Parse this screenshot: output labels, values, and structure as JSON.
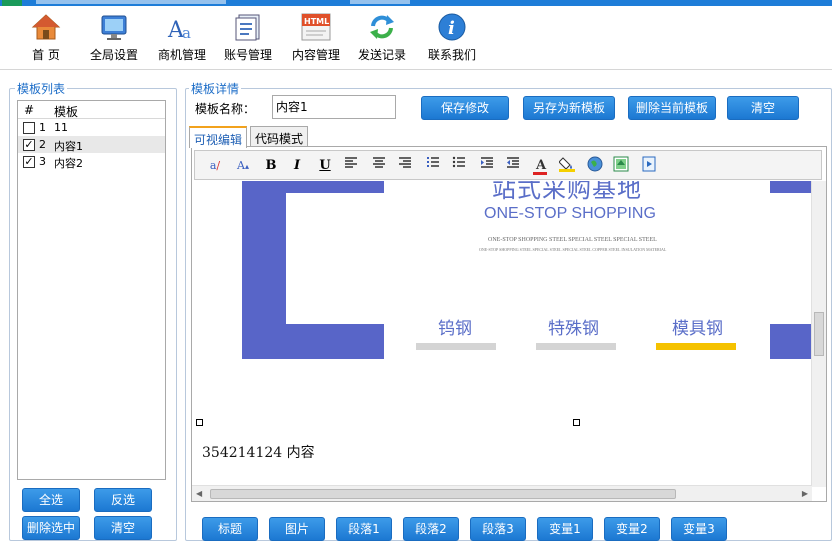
{
  "toolbar": {
    "items": [
      {
        "label": "首 页",
        "icon": "home-icon"
      },
      {
        "label": "全局设置",
        "icon": "monitor-settings-icon"
      },
      {
        "label": "商机管理",
        "icon": "font-aa-icon"
      },
      {
        "label": "账号管理",
        "icon": "account-list-icon"
      },
      {
        "label": "内容管理",
        "icon": "html-doc-icon"
      },
      {
        "label": "发送记录",
        "icon": "refresh-arrows-icon"
      },
      {
        "label": "联系我们",
        "icon": "info-icon"
      }
    ],
    "html_badge": "HTML"
  },
  "template_list": {
    "title": "模板列表",
    "columns": [
      "#",
      "模板"
    ],
    "rows": [
      {
        "num": "1",
        "name": "11",
        "checked": false
      },
      {
        "num": "2",
        "name": "内容1",
        "checked": true
      },
      {
        "num": "3",
        "name": "内容2",
        "checked": true
      }
    ],
    "buttons": {
      "select_all": "全选",
      "invert": "反选",
      "delete_selected": "删除选中",
      "clear": "清空"
    }
  },
  "template_detail": {
    "title": "模板详情",
    "name_label": "模板名称：",
    "name_value": "内容1",
    "buttons": {
      "save": "保存修改",
      "save_as": "另存为新模板",
      "delete": "删除当前模板",
      "clear": "清空"
    },
    "tabs": [
      "可视编辑",
      "代码模式"
    ],
    "active_tab": "可视编辑"
  },
  "editor_content": {
    "headline": "站式采购基地",
    "subtitle": "ONE-STOP SHOPPING",
    "small_line_1": "ONE-STOP SHOPPING STEEL SPECIAL STEEL SPECIAL STEEL",
    "small_line_2": "ONE-STOP SHOPPING STEEL SPECIAL STEEL SPECIAL STEEL COPPER STEEL INSULATION MATERIAL",
    "categories": [
      {
        "label": "钨钢",
        "active": false
      },
      {
        "label": "特殊钢",
        "active": false
      },
      {
        "label": "模具钢",
        "active": true
      }
    ],
    "body_text": "354214124 内容",
    "colors": {
      "frame_blue": "#5865c8",
      "text_blue": "#5a6ec8",
      "underline_gray": "#d4d4d4",
      "underline_active": "#f5c200"
    }
  },
  "insert_buttons": [
    "标题",
    "图片",
    "段落1",
    "段落2",
    "段落3",
    "变量1",
    "变量2",
    "变量3"
  ],
  "editor_toolbar_glyphs": {
    "bold": "B",
    "italic": "I",
    "underline": "U"
  }
}
